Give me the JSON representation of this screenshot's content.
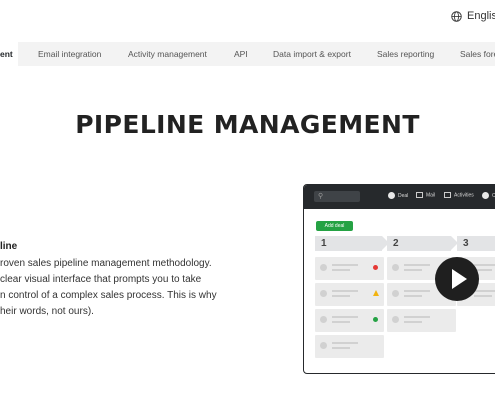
{
  "language": {
    "label": "English",
    "icon": "globe-icon"
  },
  "tabs": [
    {
      "label": "ent",
      "active": true
    },
    {
      "label": "Email integration"
    },
    {
      "label": "Activity management"
    },
    {
      "label": "API"
    },
    {
      "label": "Data import & export"
    },
    {
      "label": "Sales reporting"
    },
    {
      "label": "Sales fore"
    }
  ],
  "page_title": "PIPELINE MANAGEMENT",
  "feature": {
    "title": "line",
    "lines": [
      "roven sales pipeline management methodology.",
      "clear visual interface that prompts you to take",
      "n control of a complex sales process. This is why",
      "heir words, not ours)."
    ]
  },
  "mockup": {
    "nav": [
      "Deal",
      "Mail",
      "Activities",
      "Co"
    ],
    "add_button": "Add deal",
    "stages": [
      "1",
      "2",
      "3"
    ],
    "status_colors": {
      "red": "#e53935",
      "yellow": "#f2b30f",
      "green": "#25a244"
    },
    "card_status": [
      "red",
      "yellow",
      "green"
    ]
  },
  "video": {
    "icon": "play-icon"
  },
  "colors": {
    "accent_green": "#25a244",
    "dark": "#26292c",
    "tab_bar": "#f3f3f3"
  }
}
